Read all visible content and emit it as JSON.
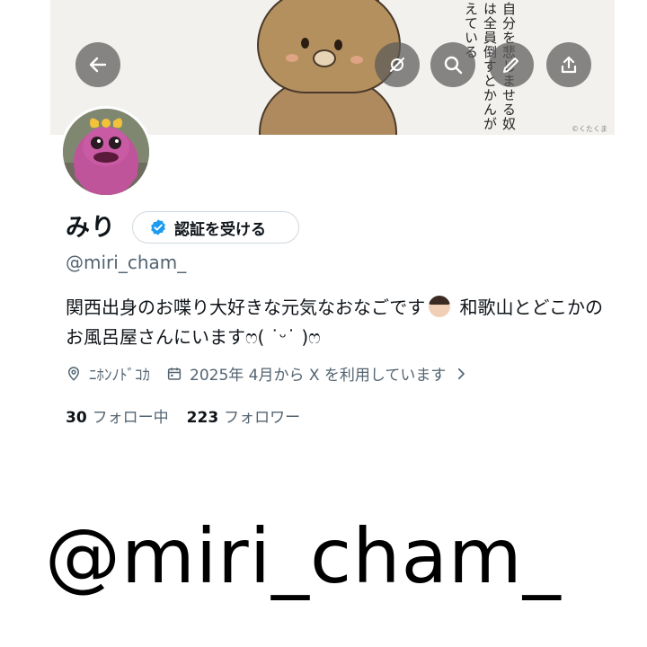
{
  "header": {
    "banner_text": "自分を悲しませる奴は全員倒すとかんがえている",
    "banner_credit": "©くたくま",
    "buttons": [
      {
        "name": "back",
        "icon": "arrow-left-icon"
      },
      {
        "name": "hide",
        "icon": "eye-slash-icon"
      },
      {
        "name": "search",
        "icon": "search-icon"
      },
      {
        "name": "edit",
        "icon": "pencil-icon"
      },
      {
        "name": "share",
        "icon": "share-icon"
      }
    ]
  },
  "profile": {
    "display_name": "みり",
    "verify_label": "認証を受ける",
    "handle": "@miri_cham_",
    "bio_part1": "関西出身のお喋り大好きな元気なおなごです",
    "bio_part2": " 和歌山とどこかのお風呂屋さんにいますෆ( ˙ᵕ˙ )ෆ",
    "location": "ﾆﾎﾝﾉﾄﾞｺｶ",
    "joined": "2025年 4月から X を利用しています",
    "following_count": "30",
    "following_label": "フォロー中",
    "followers_count": "223",
    "followers_label": "フォロワー"
  },
  "overlay": {
    "caption": "@miri_cham_"
  },
  "colors": {
    "verified_blue": "#1d9bf0",
    "muted_text": "#536471"
  }
}
